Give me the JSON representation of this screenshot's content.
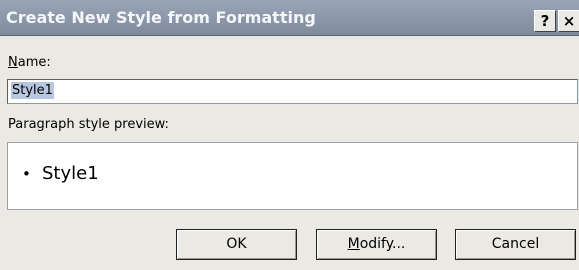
{
  "dialog": {
    "title": "Create New Style from Formatting",
    "help_button": "?",
    "close_button": "×"
  },
  "name_field": {
    "label_accel": "N",
    "label_rest": "ame:",
    "value": "Style1"
  },
  "preview": {
    "label": "Paragraph style preview:",
    "bullet": "•",
    "text": "Style1"
  },
  "buttons": {
    "ok": "OK",
    "modify_accel": "M",
    "modify_rest": "odify...",
    "cancel": "Cancel"
  }
}
